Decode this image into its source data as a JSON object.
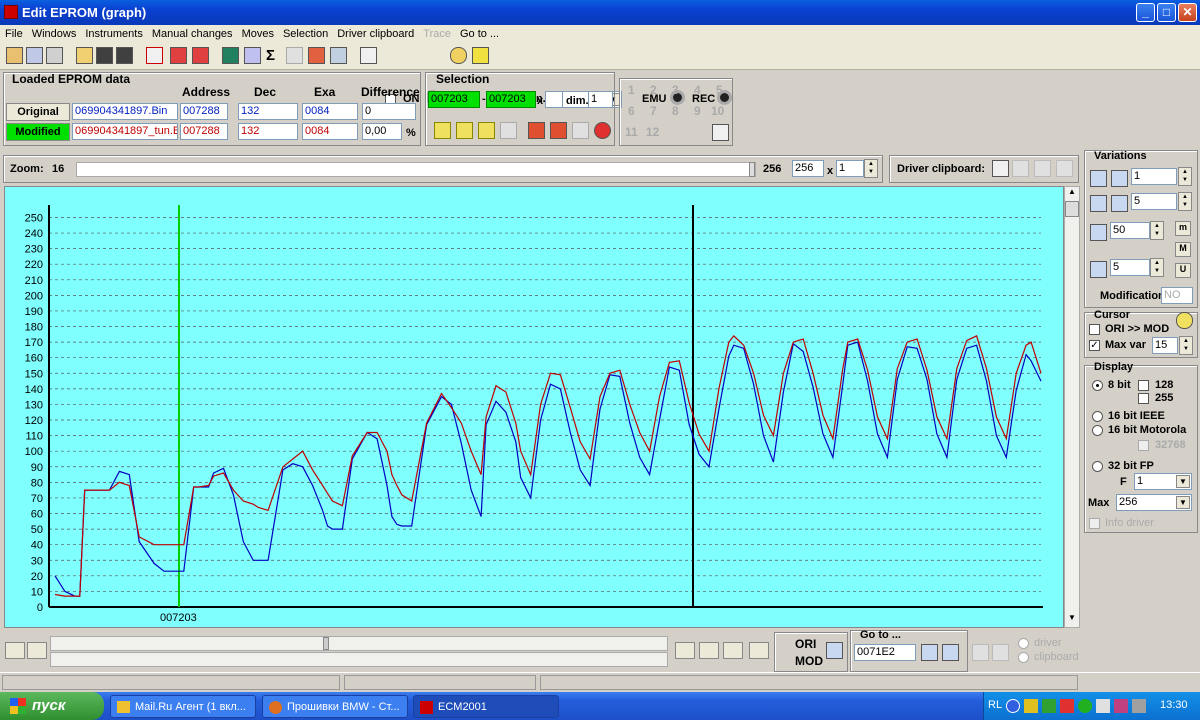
{
  "window": {
    "title": "Edit EPROM (graph)",
    "min": "_",
    "max": "□",
    "close": "✕"
  },
  "menu": [
    "File",
    "Windows",
    "Instruments",
    "Manual changes",
    "Moves",
    "Selection",
    "Driver clipboard",
    "Trace",
    "Go to ..."
  ],
  "toolbar": {
    "on_label": "ON",
    "tscan_label": "T. scan.:",
    "tscan_value": "",
    "emu_label": "EMU",
    "rec_label": "REC"
  },
  "loaded": {
    "title": "Loaded EPROM data",
    "headers": {
      "address": "Address",
      "dec": "Dec",
      "exa": "Exa",
      "difference": "Difference"
    },
    "original": {
      "label": "Original",
      "file": "069904341897.Bin",
      "address": "007288",
      "dec": "132",
      "exa": "0084",
      "diff": "0"
    },
    "modified": {
      "label": "Modified",
      "file": "069904341897_tun.Bi",
      "address": "007288",
      "dec": "132",
      "exa": "0084",
      "diff": "0,00",
      "unit": "%"
    }
  },
  "selection": {
    "title": "Selection",
    "from": "007203",
    "dash": "-",
    "to": "007203",
    "x": "x",
    "x_value": "",
    "dim_label": "dim.",
    "dim_value": "1"
  },
  "numgrid": [
    "1",
    "2",
    "3",
    "4",
    "5",
    "6",
    "7",
    "8",
    "9",
    "10",
    "11",
    "12"
  ],
  "zoom": {
    "label": "Zoom:",
    "value": "16",
    "max": "256",
    "field": "256",
    "x": "x",
    "mult": "1"
  },
  "driver_clipboard": {
    "label": "Driver clipboard:"
  },
  "variations": {
    "title": "Variations",
    "v1": "1",
    "v2": "5",
    "v3": "50",
    "v4": "5",
    "m": "m",
    "M": "M",
    "U": "U",
    "modification_label": "Modification",
    "modification_value": "NO"
  },
  "cursor": {
    "title": "Cursor",
    "ori_mod": "ORI >> MOD",
    "max_var_label": "Max var",
    "max_var_value": "15",
    "max_var_checked": "✓"
  },
  "display": {
    "title": "Display",
    "bit8": "8 bit",
    "c128": "128",
    "c255": "255",
    "bit16ieee": "16 bit IEEE",
    "bit16mot": "16 bit Motorola",
    "c32768": "32768",
    "bit32fp": "32 bit FP",
    "f_label": "F",
    "f_value": "1",
    "max_label": "Max",
    "max_value": "256",
    "info_driver": "Info driver"
  },
  "bottom": {
    "ori": "ORI",
    "mod": "MOD",
    "goto_label": "Go to ...",
    "goto_value": "0071E2",
    "driver": "driver",
    "clipboard": "clipboard"
  },
  "cursor_address": "007203",
  "taskbar": {
    "start": "пуск",
    "tasks": [
      "Mail.Ru Агент (1 вкл...",
      "Прошивки BMW - Ст...",
      "ECM2001"
    ],
    "lang": "RL",
    "clock": "13:30"
  },
  "chart_data": {
    "type": "line",
    "ylim": [
      0,
      256
    ],
    "yticks": [
      0,
      10,
      20,
      30,
      40,
      50,
      60,
      70,
      80,
      90,
      100,
      110,
      120,
      130,
      140,
      150,
      160,
      170,
      180,
      190,
      200,
      210,
      220,
      230,
      240,
      250
    ],
    "grid": true,
    "xrange": [
      0,
      100
    ],
    "series": [
      {
        "color": "#0000c0",
        "x": [
          0,
          2,
          4,
          5,
          6,
          7,
          9,
          11,
          13,
          15,
          17,
          20,
          22,
          24,
          26,
          28,
          29,
          31,
          32,
          34,
          36,
          38,
          40,
          41,
          43,
          46,
          48,
          50,
          52,
          54,
          55,
          56,
          58,
          60,
          63,
          65,
          67,
          68,
          69,
          70,
          72,
          75,
          78,
          80,
          82,
          84,
          86,
          87,
          89,
          91,
          93,
          94,
          96,
          98,
          100,
          102,
          104,
          106,
          108,
          110,
          112,
          114,
          116,
          118,
          120,
          122,
          124,
          126,
          128,
          130,
          132,
          134,
          136,
          137,
          139,
          141,
          143,
          145,
          147,
          149,
          151,
          153,
          155,
          157,
          159,
          160,
          162,
          164,
          166,
          168,
          170,
          172,
          174,
          176,
          178,
          180,
          182,
          184,
          186,
          188,
          190,
          192,
          194,
          196,
          197,
          199
        ],
        "y": [
          20,
          10,
          7,
          7,
          75,
          75,
          75,
          75,
          87,
          85,
          42,
          28,
          23,
          23,
          23,
          77,
          77,
          77,
          86,
          89,
          72,
          42,
          30,
          30,
          30,
          88,
          92,
          90,
          78,
          62,
          52,
          50,
          50,
          95,
          112,
          108,
          78,
          58,
          53,
          52,
          52,
          117,
          135,
          130,
          105,
          75,
          58,
          117,
          132,
          125,
          106,
          83,
          70,
          120,
          143,
          140,
          112,
          88,
          78,
          127,
          149,
          148,
          118,
          96,
          85,
          120,
          154,
          152,
          117,
          98,
          90,
          127,
          161,
          168,
          166,
          143,
          110,
          93,
          138,
          169,
          164,
          141,
          111,
          96,
          143,
          168,
          170,
          145,
          111,
          96,
          146,
          167,
          166,
          146,
          111,
          96,
          146,
          166,
          168,
          145,
          110,
          96,
          139,
          162,
          158,
          145
        ]
      },
      {
        "color": "#c00000",
        "x": [
          0,
          2,
          4,
          5,
          6,
          7,
          9,
          11,
          13,
          15,
          17,
          20,
          22,
          24,
          26,
          28,
          29,
          31,
          32,
          34,
          36,
          38,
          40,
          41,
          43,
          46,
          48,
          50,
          52,
          54,
          55,
          56,
          58,
          60,
          63,
          65,
          67,
          68,
          69,
          70,
          72,
          75,
          78,
          80,
          82,
          84,
          86,
          87,
          89,
          91,
          93,
          94,
          96,
          98,
          100,
          102,
          104,
          106,
          108,
          110,
          112,
          114,
          116,
          118,
          120,
          122,
          124,
          126,
          128,
          130,
          132,
          134,
          136,
          137,
          139,
          141,
          143,
          145,
          147,
          149,
          151,
          153,
          155,
          157,
          159,
          160,
          162,
          164,
          166,
          168,
          170,
          172,
          174,
          176,
          178,
          180,
          182,
          184,
          186,
          188,
          190,
          192,
          194,
          196,
          197,
          199
        ],
        "y": [
          8,
          7,
          7,
          7,
          75,
          75,
          75,
          75,
          80,
          78,
          45,
          40,
          40,
          40,
          40,
          77,
          77,
          78,
          84,
          86,
          75,
          68,
          66,
          64,
          62,
          90,
          95,
          100,
          88,
          78,
          73,
          68,
          65,
          97,
          112,
          112,
          100,
          85,
          78,
          72,
          68,
          118,
          137,
          128,
          118,
          100,
          85,
          122,
          142,
          138,
          118,
          100,
          85,
          130,
          150,
          149,
          128,
          106,
          95,
          135,
          150,
          152,
          130,
          112,
          100,
          135,
          157,
          158,
          131,
          111,
          100,
          140,
          170,
          174,
          168,
          150,
          123,
          110,
          150,
          170,
          172,
          150,
          123,
          108,
          153,
          170,
          172,
          152,
          122,
          108,
          153,
          170,
          172,
          152,
          122,
          108,
          153,
          171,
          174,
          153,
          122,
          108,
          150,
          168,
          170,
          150
        ]
      }
    ]
  }
}
